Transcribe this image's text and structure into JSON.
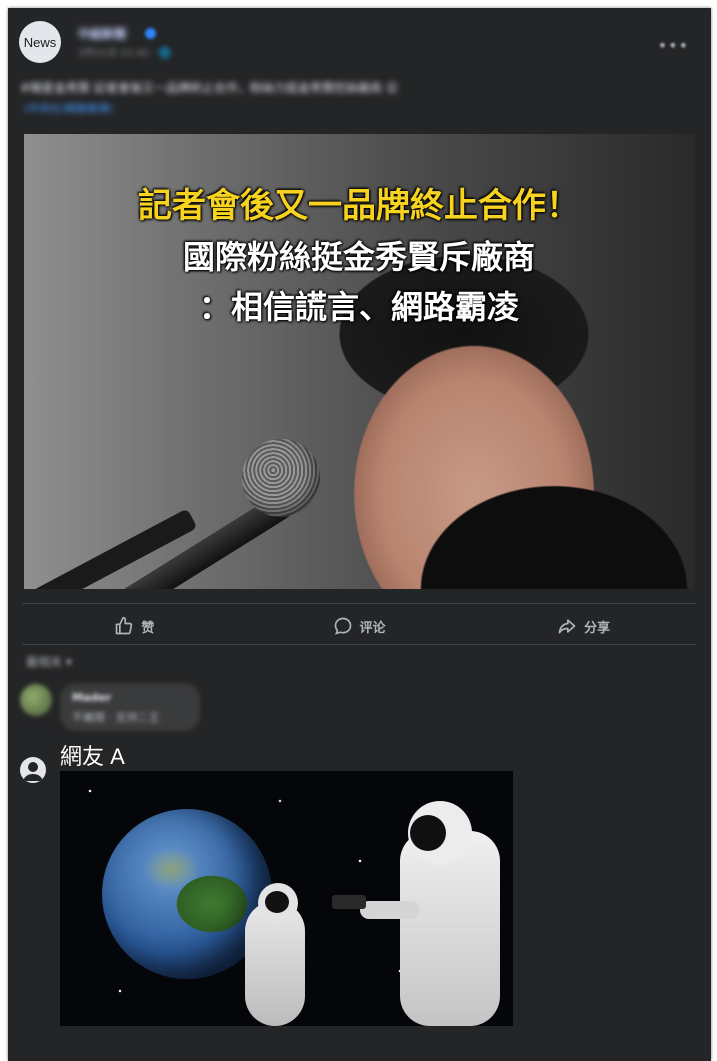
{
  "post": {
    "avatar_text": "News",
    "page_name": "中組新聞",
    "meta": "3月31日 21:42 · 🌐",
    "caption": "#韓星金秀賢 記者會後又一品牌終止合作，粉絲力挺金秀賢控訴廠商 😮",
    "caption_link": "(中央社/網路報導)",
    "headline": {
      "line1": "記者會後又一品牌終止合作！",
      "line2": "國際粉絲挺金秀賢斥廠商",
      "line3": "：相信謊言、網路霸凌"
    }
  },
  "actions": {
    "like": "赞",
    "comment": "评论",
    "share": "分享"
  },
  "comments": {
    "sort_label": "最相关 ▾",
    "blurred": {
      "name": "Mader",
      "text": "不離開 · 支持二王"
    },
    "user": {
      "name": "網友 A"
    }
  },
  "colors": {
    "card_bg": "#242526",
    "headline_yellow": "#f7d21f",
    "text_secondary": "#b0b3b8",
    "link_blue": "#4599ff"
  }
}
